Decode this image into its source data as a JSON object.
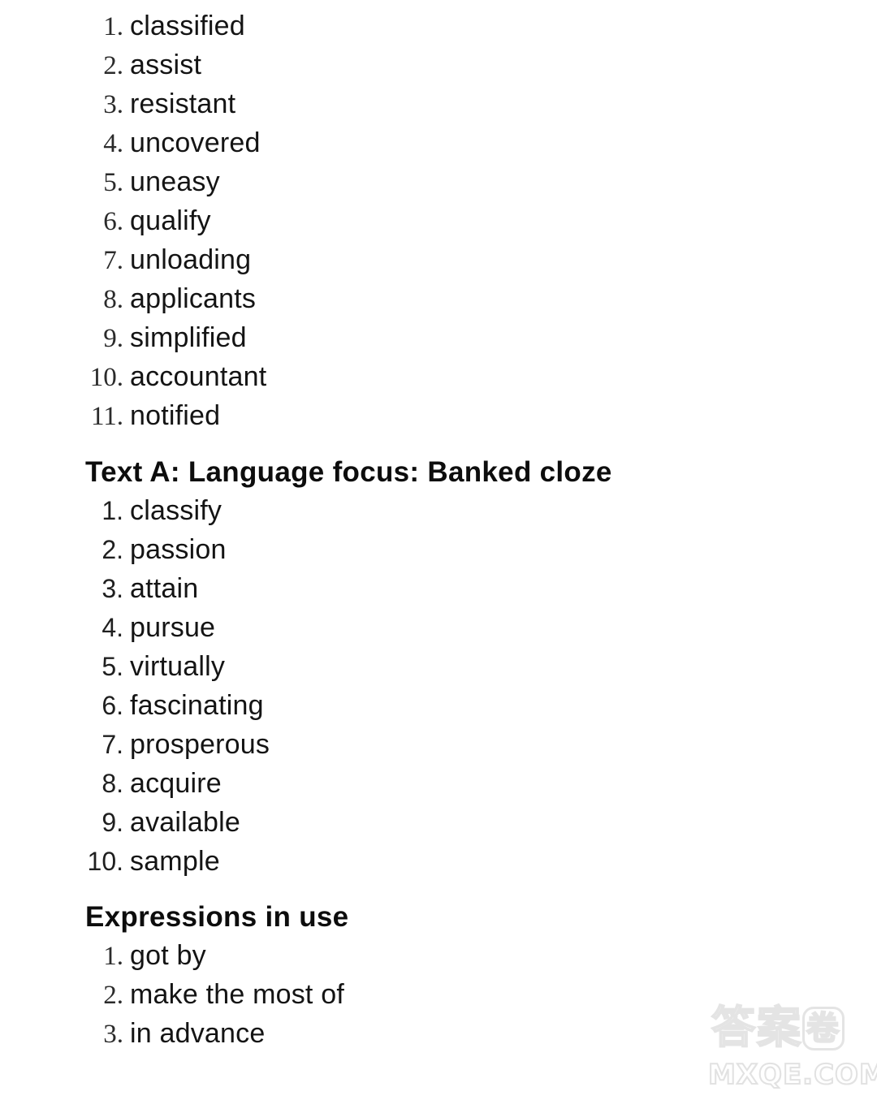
{
  "page": {
    "background_color": "#ffffff",
    "text_color": "#141414"
  },
  "sections": [
    {
      "id": "section-one",
      "heading": null,
      "numeral_style": "serif",
      "items": [
        {
          "number": "1.",
          "word": "classified"
        },
        {
          "number": "2.",
          "word": "assist"
        },
        {
          "number": "3.",
          "word": "resistant"
        },
        {
          "number": "4.",
          "word": "uncovered"
        },
        {
          "number": "5.",
          "word": "uneasy"
        },
        {
          "number": "6.",
          "word": "qualify"
        },
        {
          "number": "7.",
          "word": "unloading"
        },
        {
          "number": "8.",
          "word": "applicants"
        },
        {
          "number": "9.",
          "word": "simplified"
        },
        {
          "number": "10.",
          "word": "accountant"
        },
        {
          "number": "11.",
          "word": "notified"
        }
      ]
    },
    {
      "id": "section-banked-cloze",
      "heading": "Text A: Language focus: Banked cloze",
      "numeral_style": "sans",
      "items": [
        {
          "number": "1.",
          "word": "classify"
        },
        {
          "number": "2.",
          "word": "passion"
        },
        {
          "number": "3.",
          "word": "attain"
        },
        {
          "number": "4.",
          "word": "pursue"
        },
        {
          "number": "5.",
          "word": "virtually"
        },
        {
          "number": "6.",
          "word": "fascinating"
        },
        {
          "number": "7.",
          "word": "prosperous"
        },
        {
          "number": "8.",
          "word": "acquire"
        },
        {
          "number": "9.",
          "word": "available"
        },
        {
          "number": "10.",
          "word": "sample"
        }
      ]
    },
    {
      "id": "section-expressions",
      "heading": "Expressions in use",
      "numeral_style": "serif",
      "items": [
        {
          "number": "1.",
          "word": "got by"
        },
        {
          "number": "2.",
          "word": "make the most of"
        },
        {
          "number": "3.",
          "word": "in advance"
        }
      ]
    }
  ],
  "watermark": {
    "cjk_text": "答案",
    "cjk_circled": "卷",
    "domain": "MXQE.COM",
    "color": "#e4e4e4"
  }
}
